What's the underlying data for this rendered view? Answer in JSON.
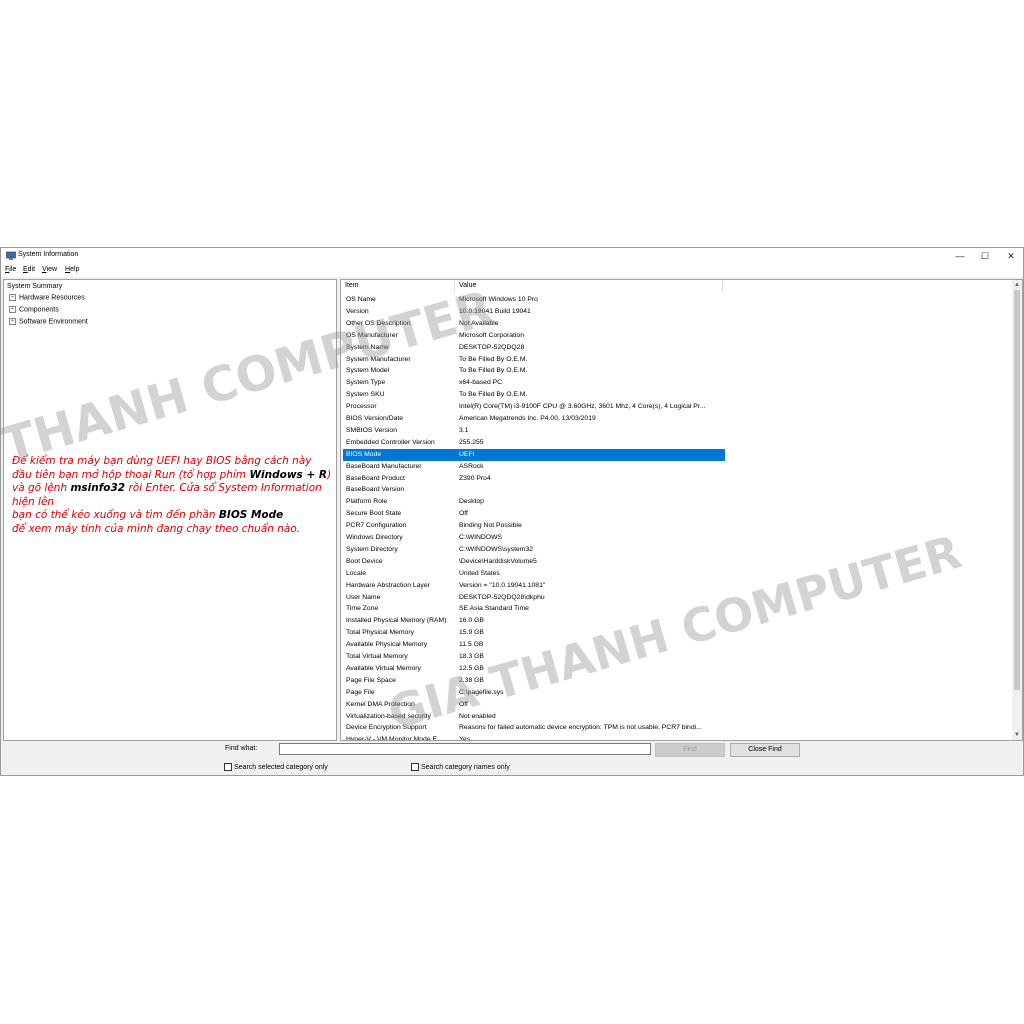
{
  "window": {
    "title": "System Information",
    "controls": {
      "minimize": "—",
      "maximize": "☐",
      "close": "✕"
    }
  },
  "menu": [
    {
      "label": "File",
      "accel": "F",
      "rest": "ile"
    },
    {
      "label": "Edit",
      "accel": "E",
      "rest": "dit"
    },
    {
      "label": "View",
      "accel": "V",
      "rest": "iew"
    },
    {
      "label": "Help",
      "accel": "H",
      "rest": "elp"
    }
  ],
  "tree": {
    "root": "System Summary",
    "children": [
      "Hardware Resources",
      "Components",
      "Software Environment"
    ]
  },
  "table": {
    "headers": [
      "Item",
      "Value"
    ],
    "selected_index": 14,
    "rows": [
      [
        "OS Name",
        "Microsoft Windows 10 Pro"
      ],
      [
        "Version",
        "10.0.19041 Build 19041"
      ],
      [
        "Other OS Description",
        "Not Available"
      ],
      [
        "OS Manufacturer",
        "Microsoft Corporation"
      ],
      [
        "System Name",
        "DESKTOP-52QDQ28"
      ],
      [
        "System Manufacturer",
        "To Be Filled By O.E.M."
      ],
      [
        "System Model",
        "To Be Filled By O.E.M."
      ],
      [
        "System Type",
        "x64-based PC"
      ],
      [
        "System SKU",
        "To Be Filled By O.E.M."
      ],
      [
        "Processor",
        "Intel(R) Core(TM) i3-9100F CPU @ 3.60GHz, 3601 Mhz, 4 Core(s), 4 Logical Pr..."
      ],
      [
        "BIOS Version/Date",
        "American Megatrends Inc. P4.00, 13/03/2019"
      ],
      [
        "SMBIOS Version",
        "3.1"
      ],
      [
        "Embedded Controller Version",
        "255.255"
      ],
      [
        "BIOS Mode",
        "UEFI"
      ],
      [
        "BaseBoard Manufacturer",
        "ASRock"
      ],
      [
        "BaseBoard Product",
        "Z390 Pro4"
      ],
      [
        "BaseBoard Version",
        ""
      ],
      [
        "Platform Role",
        "Desktop"
      ],
      [
        "Secure Boot State",
        "Off"
      ],
      [
        "PCR7 Configuration",
        "Binding Not Possible"
      ],
      [
        "Windows Directory",
        "C:\\WINDOWS"
      ],
      [
        "System Directory",
        "C:\\WINDOWS\\system32"
      ],
      [
        "Boot Device",
        "\\Device\\HarddiskVolume5"
      ],
      [
        "Locale",
        "United States"
      ],
      [
        "Hardware Abstraction Layer",
        "Version = \"10.0.19041.1081\""
      ],
      [
        "User Name",
        "DESKTOP-52QDQ28\\dkphu"
      ],
      [
        "Time Zone",
        "SE Asia Standard Time"
      ],
      [
        "Installed Physical Memory (RAM)",
        "16.0 GB"
      ],
      [
        "Total Physical Memory",
        "15.9 GB"
      ],
      [
        "Available Physical Memory",
        "11.5 GB"
      ],
      [
        "Total Virtual Memory",
        "18.3 GB"
      ],
      [
        "Available Virtual Memory",
        "12.5 GB"
      ],
      [
        "Page File Space",
        "2.38 GB"
      ],
      [
        "Page File",
        "C:\\pagefile.sys"
      ],
      [
        "Kernel DMA Protection",
        "Off"
      ],
      [
        "Virtualization-based security",
        "Not enabled"
      ],
      [
        "Device Encryption Support",
        "Reasons for failed automatic device encryption: TPM is not usable, PCR7 bindi..."
      ],
      [
        "Hyper-V - VM Monitor Mode E...",
        "Yes"
      ]
    ]
  },
  "find": {
    "label": "Find what:",
    "value": "",
    "find_button": "Find",
    "close_button": "Close Find",
    "check1": "Search selected category only",
    "check2": "Search category names only"
  },
  "annotation": {
    "line1": "Để kiểm tra máy bạn dùng UEFI hay BIOS bằng cách này",
    "line2a": "đầu tiên bạn mở hộp thoại Run (tổ hợp phím ",
    "line2b": "Windows + R",
    "line2c": ")",
    "line3a": "và gõ lệnh ",
    "line3b": "msinfo32",
    "line3c": " rồi Enter. Cửa sổ System Information hiện lên",
    "line4a": "bạn có thể kéo xuống và tìm đến phần ",
    "line4b": "BIOS Mode",
    "line5": "để xem máy tính của mình đang chạy theo chuẩn nào."
  },
  "watermark": {
    "text1": "THANH COMPUTER",
    "text2": "GIA THANH COMPUTER"
  },
  "colors": {
    "selection": "#0078d7",
    "annotation": "#e00000",
    "watermark": "rgba(150,150,150,0.42)"
  }
}
